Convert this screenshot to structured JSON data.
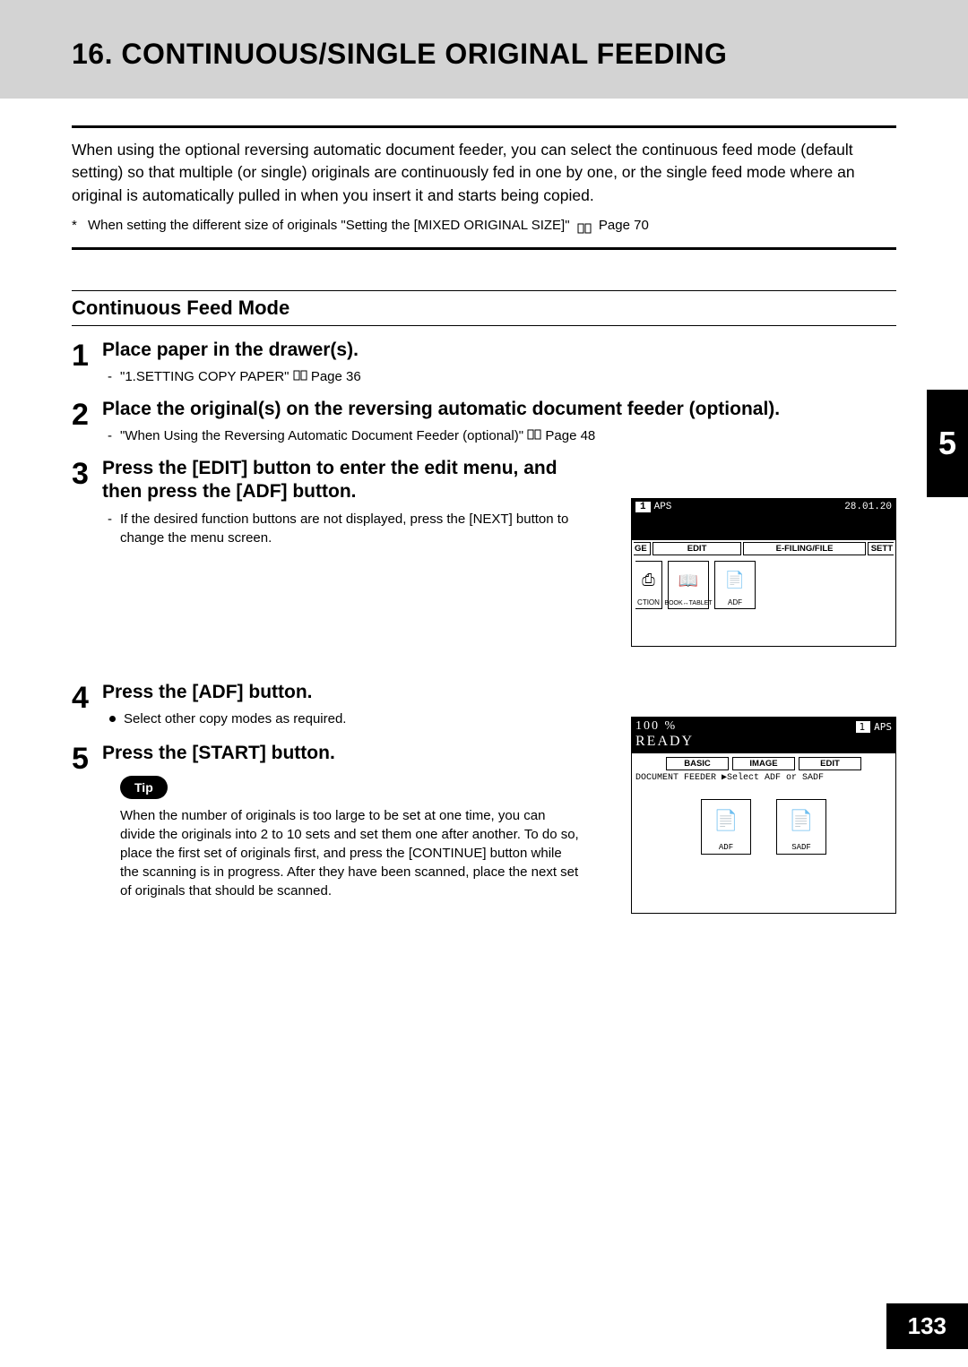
{
  "header": {
    "title": "16. CONTINUOUS/SINGLE ORIGINAL FEEDING"
  },
  "intro": {
    "paragraph": "When using the optional reversing automatic document feeder, you can select the continuous feed mode (default setting) so that multiple (or single) originals are continuously fed in one by one, or the single feed mode where an original is automatically pulled in when you insert it and starts being copied.",
    "note_prefix": "When setting the different size of originals \"Setting the [MIXED ORIGINAL SIZE]\"",
    "note_page": "Page 70"
  },
  "section": {
    "title": "Continuous Feed Mode"
  },
  "steps": [
    {
      "num": "1",
      "title": "Place paper in the drawer(s).",
      "subs": [
        {
          "text": "\"1.SETTING COPY PAPER\"",
          "page": "Page 36"
        }
      ]
    },
    {
      "num": "2",
      "title": "Place the original(s) on the reversing automatic document feeder (optional).",
      "subs": [
        {
          "text": "\"When Using the Reversing Automatic Document Feeder (optional)\"",
          "page": "Page 48"
        }
      ]
    },
    {
      "num": "3",
      "title": "Press the [EDIT] button to enter the edit menu, and then press the [ADF] button.",
      "subs": [
        {
          "text": "If the desired function buttons are not displayed, press the [NEXT] button to change the menu screen."
        }
      ]
    },
    {
      "num": "4",
      "title": "Press the [ADF] button.",
      "bullets": [
        "Select other copy modes as required."
      ]
    },
    {
      "num": "5",
      "title": "Press the [START] button.",
      "tip_label": "Tip",
      "tip_text": "When the number of originals is too large to be set at one time, you can divide the originals into 2 to 10 sets and set them one after another. To do so, place the first set of originals first, and press the [CONTINUE] button while the scanning is in progress. After they have been scanned, place the next set of originals that should be scanned."
    }
  ],
  "side_tab": "5",
  "page_number": "133",
  "figure1": {
    "top_num": "1",
    "top_aps": "APS",
    "top_date": "28.01.20",
    "tabs": [
      "GE",
      "EDIT",
      "E-FILING/FILE",
      "SETT"
    ],
    "buttons": [
      "CTION",
      "BOOK↔TABLET",
      "ADF"
    ]
  },
  "figure2": {
    "pct": "100 %",
    "top_num": "1",
    "top_aps": "APS",
    "ready": "READY",
    "tabs": [
      "BASIC",
      "IMAGE",
      "EDIT"
    ],
    "subtitle": "DOCUMENT FEEDER  ▶Select ADF or SADF",
    "buttons": [
      "ADF",
      "SADF"
    ]
  }
}
